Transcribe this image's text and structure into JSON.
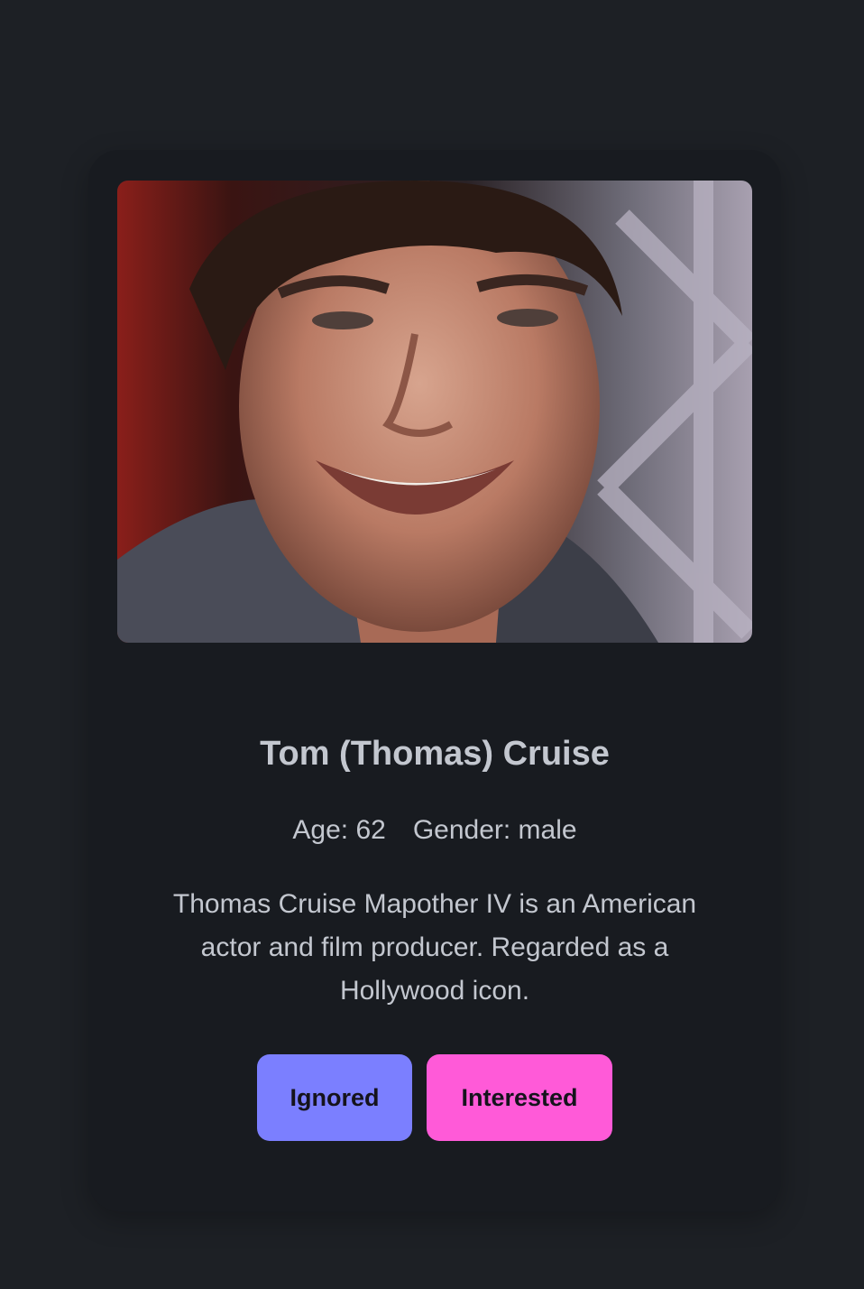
{
  "profile": {
    "photo_alt": "Tom (Thomas) Cruise",
    "name": "Tom (Thomas) Cruise",
    "age_text": "Age: 62",
    "gender_text": "Gender: male",
    "bio": "Thomas Cruise Mapother IV is an American actor and film producer. Regarded as a Hollywood icon."
  },
  "actions": {
    "ignored_label": "Ignored",
    "interested_label": "Interested"
  },
  "colors": {
    "page_bg": "#1d2025",
    "card_bg": "#181b20",
    "text": "#c3c7cf",
    "ignored_button": "#7b7fff",
    "interested_button": "#ff5ad8"
  }
}
